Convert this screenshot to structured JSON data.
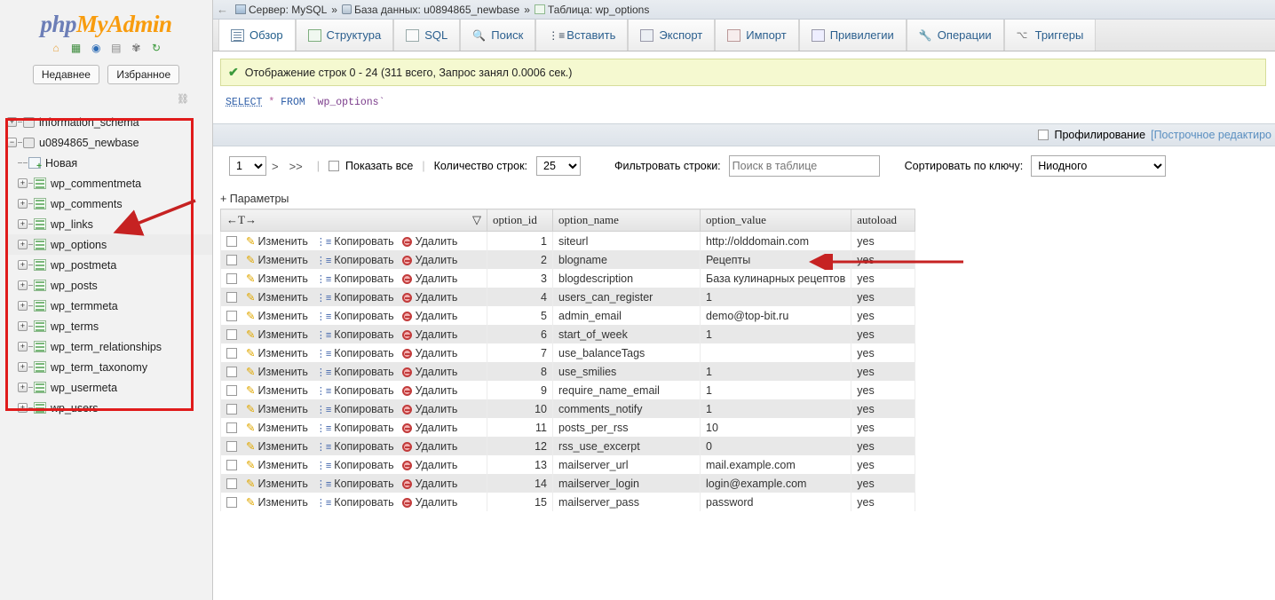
{
  "brand": {
    "php": "php",
    "my": "My",
    "admin": "Admin"
  },
  "sidebar": {
    "icons": [
      {
        "name": "home-icon",
        "glyph": "⌂"
      },
      {
        "name": "database-icon",
        "glyph": "▤"
      },
      {
        "name": "help-icon",
        "glyph": "?"
      },
      {
        "name": "documentation-icon",
        "glyph": "▢"
      },
      {
        "name": "settings-gear-icon",
        "glyph": "✿"
      },
      {
        "name": "reload-icon",
        "glyph": "↻"
      }
    ],
    "recent_label": "Недавнее",
    "favorites_label": "Избранное",
    "tree": [
      {
        "label": "information_schema",
        "type": "db",
        "expander": "+",
        "highlight": false
      },
      {
        "label": "u0894865_newbase",
        "type": "db",
        "expander": "−",
        "highlight": false
      },
      {
        "label": "Новая",
        "type": "new",
        "expander": "",
        "highlight": false
      },
      {
        "label": "wp_commentmeta",
        "type": "table",
        "expander": "+",
        "highlight": false
      },
      {
        "label": "wp_comments",
        "type": "table",
        "expander": "+",
        "highlight": false
      },
      {
        "label": "wp_links",
        "type": "table",
        "expander": "+",
        "highlight": false
      },
      {
        "label": "wp_options",
        "type": "table",
        "expander": "+",
        "highlight": true
      },
      {
        "label": "wp_postmeta",
        "type": "table",
        "expander": "+",
        "highlight": false
      },
      {
        "label": "wp_posts",
        "type": "table",
        "expander": "+",
        "highlight": false
      },
      {
        "label": "wp_termmeta",
        "type": "table",
        "expander": "+",
        "highlight": false
      },
      {
        "label": "wp_terms",
        "type": "table",
        "expander": "+",
        "highlight": false
      },
      {
        "label": "wp_term_relationships",
        "type": "table",
        "expander": "+",
        "highlight": false
      },
      {
        "label": "wp_term_taxonomy",
        "type": "table",
        "expander": "+",
        "highlight": false
      },
      {
        "label": "wp_usermeta",
        "type": "table",
        "expander": "+",
        "highlight": false
      },
      {
        "label": "wp_users",
        "type": "table",
        "expander": "+",
        "highlight": false
      }
    ]
  },
  "breadcrumb": {
    "server_label": "Сервер: MySQL",
    "sep1": "»",
    "database_label": "База данных: u0894865_newbase",
    "sep2": "»",
    "table_label": "Таблица: wp_options"
  },
  "tabs": [
    {
      "label": "Обзор",
      "icon": "browse-icon",
      "active": true
    },
    {
      "label": "Структура",
      "icon": "structure-icon",
      "active": false
    },
    {
      "label": "SQL",
      "icon": "sql-icon",
      "active": false
    },
    {
      "label": "Поиск",
      "icon": "search-icon",
      "active": false
    },
    {
      "label": "Вставить",
      "icon": "insert-icon",
      "active": false
    },
    {
      "label": "Экспорт",
      "icon": "export-icon",
      "active": false
    },
    {
      "label": "Импорт",
      "icon": "import-icon",
      "active": false
    },
    {
      "label": "Привилегии",
      "icon": "privileges-icon",
      "active": false
    },
    {
      "label": "Операции",
      "icon": "operations-icon",
      "active": false
    },
    {
      "label": "Триггеры",
      "icon": "triggers-icon",
      "active": false
    }
  ],
  "status": {
    "message": "Отображение строк 0 - 24 (311 всего, Запрос занял 0.0006 сек.)"
  },
  "sql": {
    "select": "SELECT",
    "star": "*",
    "from": "FROM",
    "table": "`wp_options`"
  },
  "profiling": {
    "label": "Профилирование",
    "inline_edit_link": "[Построчное редактиро"
  },
  "controls": {
    "page_value": "1",
    "next_arrow": ">",
    "last_arrow": ">>",
    "show_all_label": "Показать все",
    "rows_count_label": "Количество строк:",
    "rows_count_value": "25",
    "filter_label": "Фильтровать строки:",
    "filter_placeholder": "Поиск в таблице",
    "sort_label": "Сортировать по ключу:",
    "sort_value": "Ниодного",
    "options_label": "+ Параметры"
  },
  "table": {
    "transpose_label": "←T→",
    "columns": [
      "option_id",
      "option_name",
      "option_value",
      "autoload"
    ],
    "actions": {
      "edit": "Изменить",
      "copy": "Копировать",
      "delete": "Удалить"
    },
    "rows": [
      {
        "id": "1",
        "name": "siteurl",
        "value": "http://olddomain.com",
        "autoload": "yes"
      },
      {
        "id": "2",
        "name": "blogname",
        "value": "Рецепты",
        "autoload": "yes"
      },
      {
        "id": "3",
        "name": "blogdescription",
        "value": "База кулинарных рецептов",
        "autoload": "yes"
      },
      {
        "id": "4",
        "name": "users_can_register",
        "value": "1",
        "autoload": "yes"
      },
      {
        "id": "5",
        "name": "admin_email",
        "value": "demo@top-bit.ru",
        "autoload": "yes"
      },
      {
        "id": "6",
        "name": "start_of_week",
        "value": "1",
        "autoload": "yes"
      },
      {
        "id": "7",
        "name": "use_balanceTags",
        "value": "",
        "autoload": "yes"
      },
      {
        "id": "8",
        "name": "use_smilies",
        "value": "1",
        "autoload": "yes"
      },
      {
        "id": "9",
        "name": "require_name_email",
        "value": "1",
        "autoload": "yes"
      },
      {
        "id": "10",
        "name": "comments_notify",
        "value": "1",
        "autoload": "yes"
      },
      {
        "id": "11",
        "name": "posts_per_rss",
        "value": "10",
        "autoload": "yes"
      },
      {
        "id": "12",
        "name": "rss_use_excerpt",
        "value": "0",
        "autoload": "yes"
      },
      {
        "id": "13",
        "name": "mailserver_url",
        "value": "mail.example.com",
        "autoload": "yes"
      },
      {
        "id": "14",
        "name": "mailserver_login",
        "value": "login@example.com",
        "autoload": "yes"
      },
      {
        "id": "15",
        "name": "mailserver_pass",
        "value": "password",
        "autoload": "yes"
      }
    ]
  },
  "annotations": {
    "color": "#c62222"
  }
}
